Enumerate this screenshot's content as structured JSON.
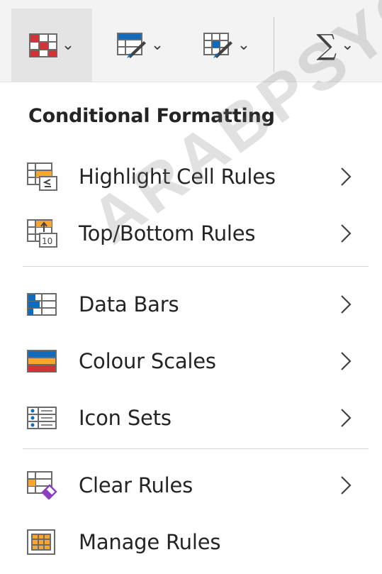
{
  "ribbon": {
    "buttons": [
      {
        "icon": "conditional-formatting-icon",
        "chevron": "⌄"
      },
      {
        "icon": "format-as-table-icon",
        "chevron": "⌄"
      },
      {
        "icon": "cell-styles-icon",
        "chevron": "⌄"
      },
      {
        "icon": "autosum-icon",
        "glyph": "∑",
        "chevron": "⌄"
      }
    ]
  },
  "menu": {
    "title": "Conditional Formatting",
    "items": [
      {
        "label": "Highlight Cell Rules",
        "icon": "highlight-cell-rules-icon",
        "has_submenu": true
      },
      {
        "label": "Top/Bottom Rules",
        "icon": "top-bottom-rules-icon",
        "has_submenu": true
      },
      {
        "label": "Data Bars",
        "icon": "data-bars-icon",
        "has_submenu": true
      },
      {
        "label": "Colour Scales",
        "icon": "colour-scales-icon",
        "has_submenu": true
      },
      {
        "label": "Icon Sets",
        "icon": "icon-sets-icon",
        "has_submenu": true
      },
      {
        "label": "Clear Rules",
        "icon": "clear-rules-icon",
        "has_submenu": true
      },
      {
        "label": "Manage Rules",
        "icon": "manage-rules-icon",
        "has_submenu": false
      }
    ]
  },
  "watermark": "ARABPSYC",
  "colors": {
    "accent_red": "#d13438",
    "accent_blue": "#0f6cbd",
    "accent_orange": "#f7a630",
    "accent_purple": "#8a3ec2"
  }
}
